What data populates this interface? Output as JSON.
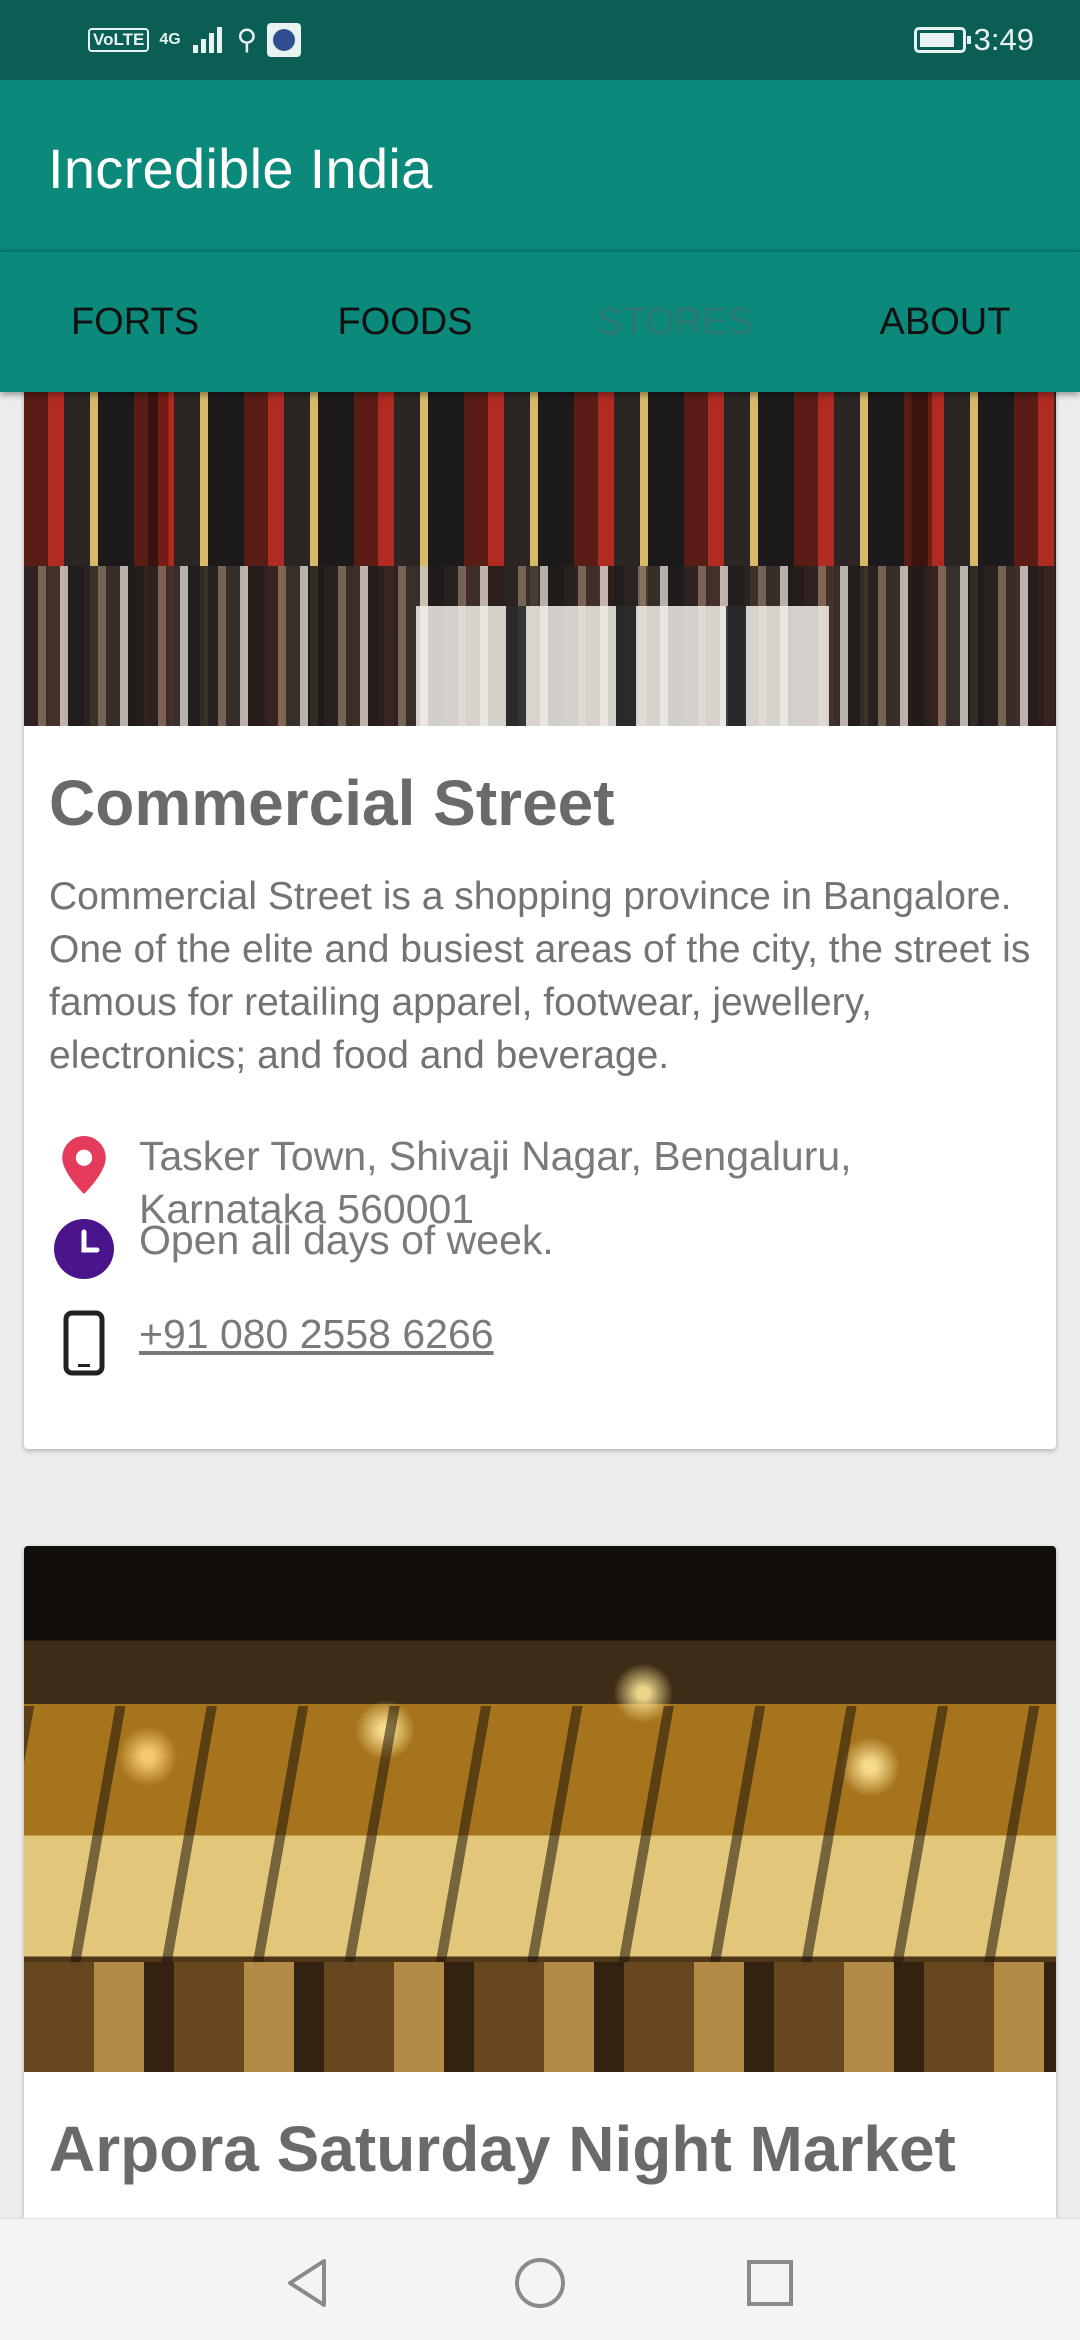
{
  "status_bar": {
    "volte": "VoLTE",
    "network": "4G",
    "time": "3:49"
  },
  "app": {
    "title": "Incredible India"
  },
  "tabs": [
    {
      "label": "FORTS"
    },
    {
      "label": "FOODS"
    },
    {
      "label": "STORES"
    },
    {
      "label": "ABOUT"
    }
  ],
  "selected_tab": "STORES",
  "cards": [
    {
      "title": "Commercial Street",
      "description": "Commercial Street is a shopping province in Bangalore. One of the elite and busiest areas of the city, the street is famous for retailing apparel, footwear, jewellery, electronics; and food and beverage.",
      "address": "Tasker Town, Shivaji Nagar, Bengaluru, Karnataka 560001",
      "hours": "Open all days of week.",
      "phone": "+91 080 2558 6266"
    },
    {
      "title": "Arpora Saturday Night Market"
    }
  ],
  "colors": {
    "app_bar": "#0b8a7c",
    "status_bar": "#0b5e54",
    "location_icon": "#e53b5b",
    "clock_icon": "#4a148c"
  },
  "icons": [
    "location-pin-icon",
    "clock-icon",
    "phone-icon",
    "back-icon",
    "home-icon",
    "recents-icon"
  ]
}
